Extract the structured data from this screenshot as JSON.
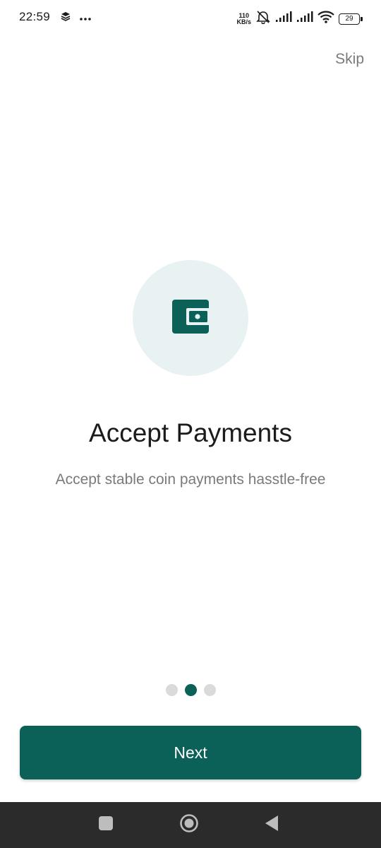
{
  "status_bar": {
    "time": "22:59",
    "net_speed_value": "110",
    "net_speed_unit": "KB/s",
    "battery": "29",
    "icons": [
      "layers-icon",
      "more-dots-icon",
      "mute-bell-icon",
      "signal-icon",
      "signal-icon",
      "wifi-icon",
      "battery-icon"
    ]
  },
  "header": {
    "skip_label": "Skip"
  },
  "onboarding": {
    "icon": "wallet-icon",
    "title": "Accept Payments",
    "subtitle": "Accept stable coin payments hasstle-free",
    "page_count": 3,
    "active_page": 2
  },
  "actions": {
    "next_label": "Next"
  },
  "nav_bar": {
    "buttons": [
      "recents-square-icon",
      "home-circle-icon",
      "back-triangle-icon"
    ]
  },
  "colors": {
    "primary": "#0b6157",
    "icon_bg": "#e8f2f2",
    "muted_text": "#7a7a7a",
    "inactive_dot": "#dadada",
    "nav_bar": "#2b2b2b"
  }
}
